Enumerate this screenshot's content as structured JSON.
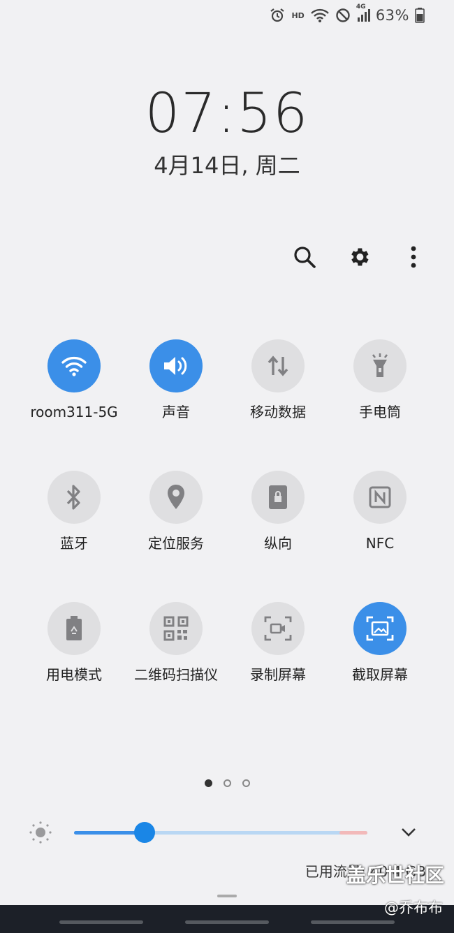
{
  "status_bar": {
    "hd": "HD",
    "network": "4G",
    "battery_pct": "63%"
  },
  "clock": {
    "time": "07:56",
    "date": "4月14日, 周二"
  },
  "top_actions": [
    "search-icon",
    "gear-icon",
    "more-vertical-icon"
  ],
  "tiles": [
    {
      "label": "room311-5G",
      "icon": "wifi-icon",
      "active": true
    },
    {
      "label": "声音",
      "icon": "volume-icon",
      "active": true
    },
    {
      "label": "移动数据",
      "icon": "mobile-data-icon",
      "active": false
    },
    {
      "label": "手电筒",
      "icon": "flashlight-icon",
      "active": false
    },
    {
      "label": "蓝牙",
      "icon": "bluetooth-icon",
      "active": false
    },
    {
      "label": "定位服务",
      "icon": "location-icon",
      "active": false
    },
    {
      "label": "纵向",
      "icon": "portrait-lock-icon",
      "active": false
    },
    {
      "label": "NFC",
      "icon": "nfc-icon",
      "active": false
    },
    {
      "label": "用电模式",
      "icon": "battery-saver-icon",
      "active": false
    },
    {
      "label": "二维码扫描仪",
      "icon": "qr-code-icon",
      "active": false
    },
    {
      "label": "录制屏幕",
      "icon": "screen-record-icon",
      "active": false
    },
    {
      "label": "截取屏幕",
      "icon": "screenshot-icon",
      "active": true
    }
  ],
  "pager": {
    "pages": 3,
    "current": 1
  },
  "brightness": {
    "level_pct": 24
  },
  "usage_text": "已用流量: 40.4 GB",
  "watermark": "盖乐世社区",
  "watermark_user": "@乔布布",
  "colors": {
    "accent": "#3b8fe8",
    "background": "#f1f1f3",
    "tile_off": "#dfdfe1"
  }
}
